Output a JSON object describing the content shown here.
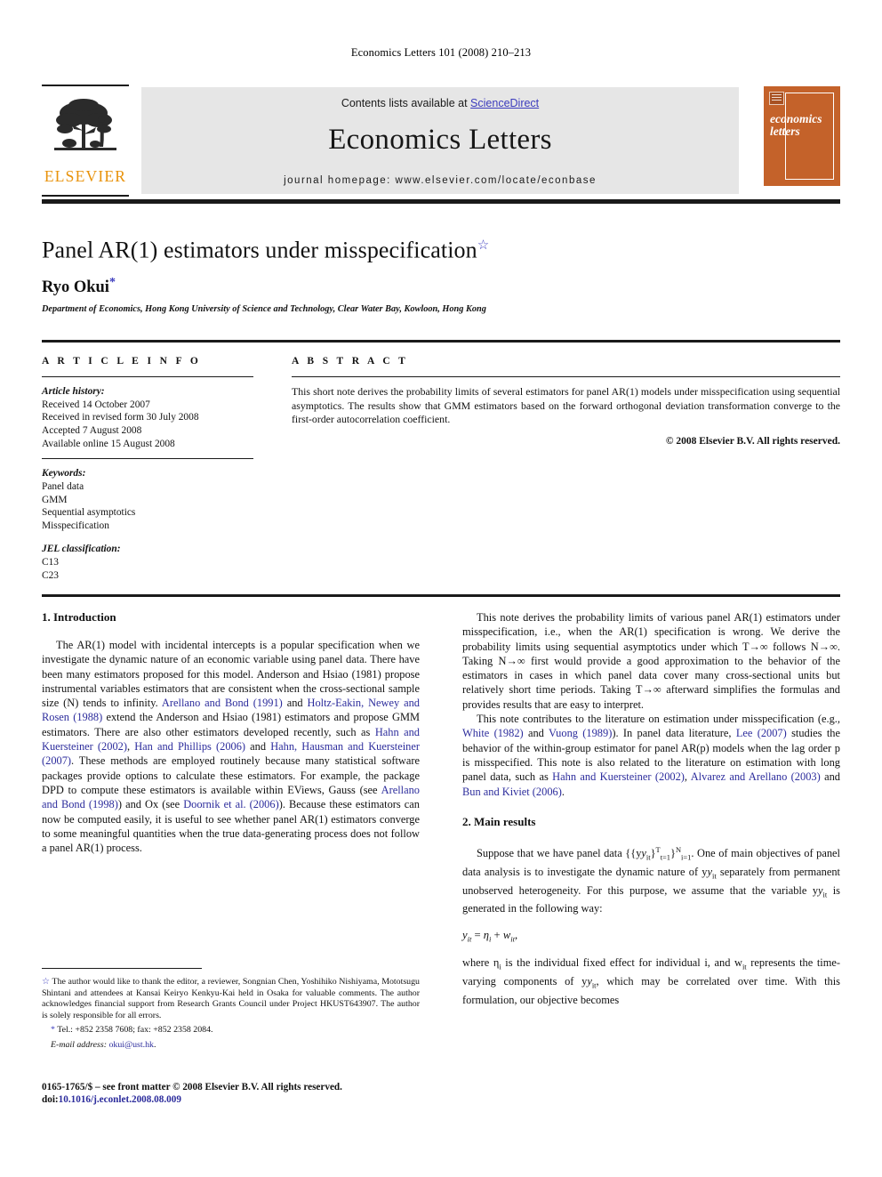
{
  "running_head": "Economics Letters 101 (2008) 210–213",
  "masthead": {
    "contents_prefix": "Contents lists available at",
    "sciencedirect_label": "ScienceDirect",
    "journal_name": "Economics Letters",
    "homepage_line": "journal homepage: www.elsevier.com/locate/econbase",
    "publisher_wordmark": "ELSEVIER",
    "cover_title_line1": "economics",
    "cover_title_line2": "letters",
    "sciencedirect_color": "#3b3bbd",
    "cover_color": "#C4622A",
    "wordmark_color": "#E8920A"
  },
  "title_block": {
    "title": "Panel AR(1) estimators under misspecification",
    "title_footnote_marker": "☆",
    "author": "Ryo Okui",
    "author_corr_marker": "*",
    "affiliation": "Department of Economics, Hong Kong University of Science and Technology, Clear Water Bay, Kowloon, Hong Kong"
  },
  "article_info": {
    "heading": "A R T I C L E   I N F O",
    "history_label": "Article history:",
    "history": [
      "Received 14 October 2007",
      "Received in revised form 30 July 2008",
      "Accepted 7 August 2008",
      "Available online 15 August 2008"
    ],
    "keywords_label": "Keywords:",
    "keywords": [
      "Panel data",
      "GMM",
      "Sequential asymptotics",
      "Misspecification"
    ],
    "jel_label": "JEL classification:",
    "jel_codes": [
      "C13",
      "C23"
    ]
  },
  "abstract": {
    "heading": "A B S T R A C T",
    "text": "This short note derives the probability limits of several estimators for panel AR(1) models under misspecification using sequential asymptotics. The results show that GMM estimators based on the forward orthogonal deviation transformation converge to the first-order autocorrelation coefficient.",
    "copyright": "© 2008 Elsevier B.V. All rights reserved."
  },
  "sections": {
    "intro_heading": "1. Introduction",
    "main_heading": "2. Main results"
  },
  "left_column": {
    "p1_a": "The AR(1) model with incidental intercepts is a popular specification when we investigate the dynamic nature of an economic variable using panel data. There have been many estimators proposed for this model. Anderson and Hsiao (1981) propose instrumental variables estimators that are consistent when the cross-sectional sample size (N) tends to infinity. ",
    "p1_cite1": "Arellano and Bond (1991)",
    "p1_b": " and ",
    "p1_cite2": "Holtz-Eakin, Newey and Rosen (1988)",
    "p1_c": " extend the Anderson and Hsiao (1981) estimators and propose GMM estimators. There are also other estimators developed recently, such as ",
    "p1_cite3": "Hahn and Kuersteiner (2002)",
    "p1_d": ", ",
    "p1_cite4": "Han and Phillips (2006)",
    "p1_e": " and ",
    "p1_cite5": "Hahn, Hausman and Kuersteiner (2007)",
    "p1_f": ". These methods are employed routinely because many statistical software packages provide options to calculate these estimators. For example, the package DPD to compute these estimators is available within EViews, Gauss (see ",
    "p1_cite6": "Arellano and Bond (1998)",
    "p1_g": ") and Ox (see ",
    "p1_cite7": "Doornik et al. (2006)",
    "p1_h": "). Because these estimators can now be computed easily, it is useful to see whether panel AR(1) estimators converge to some meaningful quantities when the true data-generating process does not follow a panel AR(1) process."
  },
  "right_column": {
    "p1": "This note derives the probability limits of various panel AR(1) estimators under misspecification, i.e., when the AR(1) specification is wrong. We derive the probability limits using sequential asymptotics under which T→∞ follows N→∞. Taking N→∞ first would provide a good approximation to the behavior of the estimators in cases in which panel data cover many cross-sectional units but relatively short time periods. Taking T→∞ afterward simplifies the formulas and provides results that are easy to interpret.",
    "p2_a": "This note contributes to the literature on estimation under misspecification (e.g., ",
    "p2_cite1": "White (1982)",
    "p2_b": " and ",
    "p2_cite2": "Vuong (1989)",
    "p2_c": "). In panel data literature, ",
    "p2_cite3": "Lee (2007)",
    "p2_d": " studies the behavior of the within-group estimator for panel AR(p) models when the lag order p is misspecified. This note is also related to the literature on estimation with long panel data, such as ",
    "p2_cite4": "Hahn and Kuersteiner (2002)",
    "p2_e": ", ",
    "p2_cite5": "Alvarez and Arellano (2003)",
    "p2_f": " and ",
    "p2_cite6": "Bun and Kiviet (2006)",
    "p2_g": ".",
    "p3_a": "Suppose that we have panel data {{y",
    "p3_math_note": "{{y_it}^T_{t=1}}^N_{i=1}",
    "p3_b": ". One of main objectives of panel data analysis is to investigate the dynamic nature of y",
    "p3_c": " separately from permanent unobserved heterogeneity. For this purpose, we assume that the variable y",
    "p3_d": " is generated in the following way:",
    "equation": "y_it = η_i + w_it,",
    "p4_a": "where η",
    "p4_b": " is the individual fixed effect for individual i, and w",
    "p4_c": " represents the time-varying components of y",
    "p4_d": ", which may be correlated over time. With this formulation, our objective becomes"
  },
  "footnote": {
    "star": "☆",
    "thanks": "The author would like to thank the editor, a reviewer, Songnian Chen, Yoshihiko Nishiyama, Mototsugu Shintani and attendees at Kansai Keiryo Kenkyu-Kai held in Osaka for valuable comments. The author acknowledges financial support from Research Grants Council under Project HKUST643907. The author is solely responsible for all errors.",
    "tel_marker": "*",
    "tel": "Tel.: +852 2358 7608; fax: +852 2358 2084.",
    "email_label": "E-mail address:",
    "email": "okui@ust.hk"
  },
  "imprint": {
    "issn_line": "0165-1765/$ – see front matter © 2008 Elsevier B.V. All rights reserved.",
    "doi_label": "doi:",
    "doi": "10.1016/j.econlet.2008.08.009"
  }
}
